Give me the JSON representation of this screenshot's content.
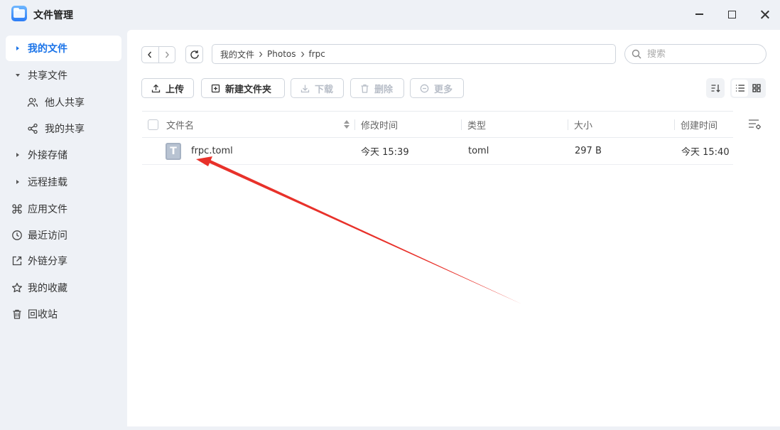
{
  "window": {
    "title": "文件管理"
  },
  "sidebar": {
    "items": [
      {
        "label": "我的文件"
      },
      {
        "label": "共享文件"
      },
      {
        "label": "他人共享"
      },
      {
        "label": "我的共享"
      },
      {
        "label": "外接存储"
      },
      {
        "label": "远程挂载"
      },
      {
        "label": "应用文件"
      },
      {
        "label": "最近访问"
      },
      {
        "label": "外链分享"
      },
      {
        "label": "我的收藏"
      },
      {
        "label": "回收站"
      }
    ]
  },
  "breadcrumb": {
    "items": [
      "我的文件",
      "Photos",
      "frpc"
    ]
  },
  "search": {
    "placeholder": "搜索"
  },
  "toolbar": {
    "upload": "上传",
    "new_folder": "新建文件夹",
    "download": "下载",
    "delete": "删除",
    "more": "更多"
  },
  "table": {
    "columns": [
      "文件名",
      "修改时间",
      "类型",
      "大小",
      "创建时间"
    ],
    "rows": [
      {
        "name": "frpc.toml",
        "icon_letter": "T",
        "modified": "今天 15:39",
        "type": "toml",
        "size": "297 B",
        "created": "今天 15:40"
      }
    ]
  },
  "colors": {
    "accent": "#1a73e8",
    "annotation_arrow": "#e8312a"
  }
}
